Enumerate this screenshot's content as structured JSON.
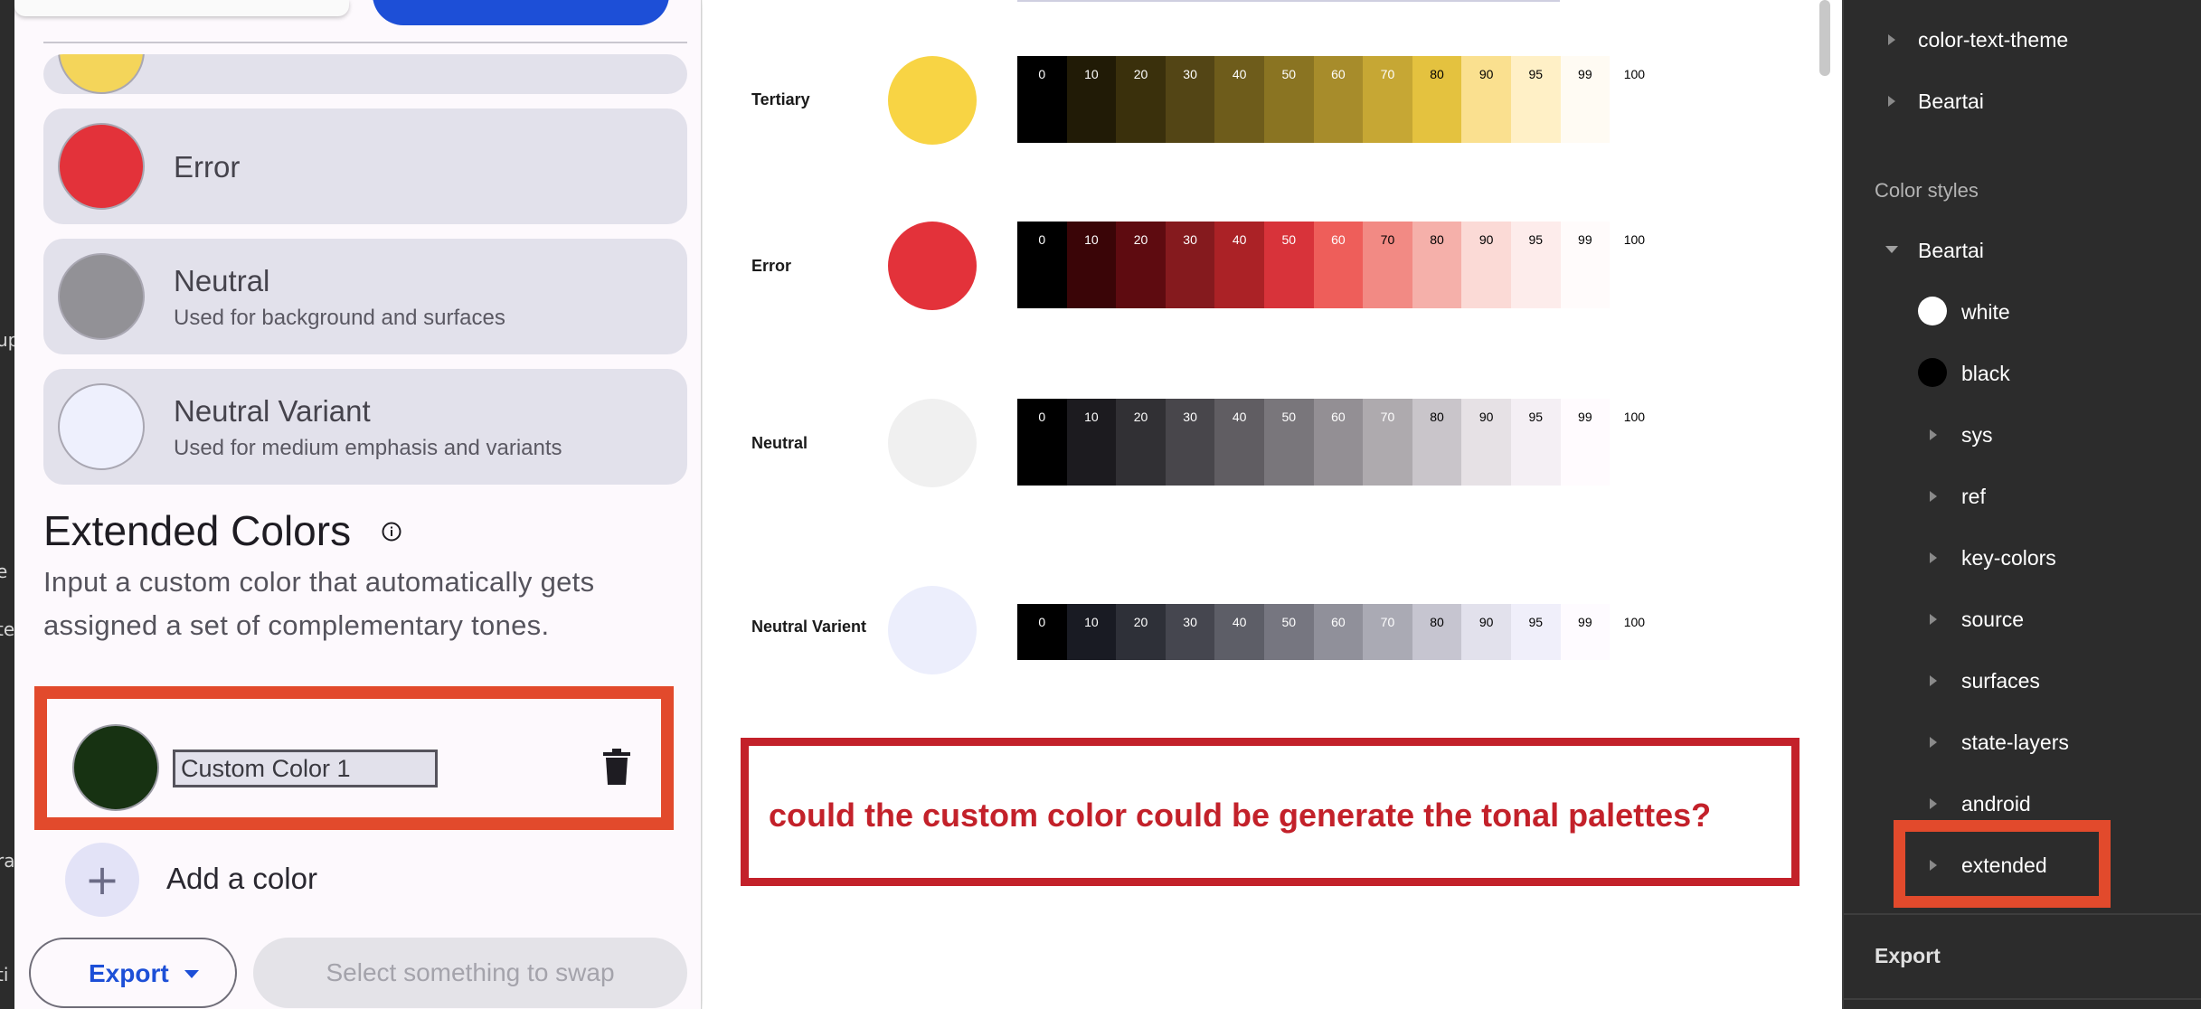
{
  "left_panel": {
    "cards": [
      {
        "title": "Error",
        "subtitle": "",
        "color": "#e3323a"
      },
      {
        "title": "Neutral",
        "subtitle": "Used for background and surfaces",
        "color": "#929196"
      },
      {
        "title": "Neutral Variant",
        "subtitle": "Used for medium emphasis and variants",
        "color": "#eef0fd"
      }
    ],
    "partial_card_color": "#f4d55a",
    "extended": {
      "title": "Extended Colors",
      "info_icon": "info-icon",
      "description": "Input a custom color that automatically gets assigned a set of complementary tones.",
      "custom_color": {
        "name_value": "Custom Color 1",
        "swatch_color": "#173212",
        "delete_icon": "trash-icon"
      },
      "add_label": "Add a color"
    },
    "export_label": "Export",
    "swap_label": "Select something to swap",
    "edge_fragments": [
      "up",
      "e",
      "te",
      "ra",
      "ti"
    ]
  },
  "palette": {
    "rows": [
      {
        "label": "Tertiary",
        "color": "#f8d444",
        "tones": [
          {
            "t": "0",
            "bg": "#000000",
            "fg": "#ffffff"
          },
          {
            "t": "10",
            "bg": "#211b06",
            "fg": "#ffffff"
          },
          {
            "t": "20",
            "bg": "#3a300c",
            "fg": "#ffffff"
          },
          {
            "t": "30",
            "bg": "#534515",
            "fg": "#ffffff"
          },
          {
            "t": "40",
            "bg": "#6e5c1b",
            "fg": "#ffffff"
          },
          {
            "t": "50",
            "bg": "#8a7422",
            "fg": "#ffffff"
          },
          {
            "t": "60",
            "bg": "#a78c2b",
            "fg": "#ffffff"
          },
          {
            "t": "70",
            "bg": "#c6a734",
            "fg": "#ffffff"
          },
          {
            "t": "80",
            "bg": "#e4c23f",
            "fg": "#000000"
          },
          {
            "t": "90",
            "bg": "#fae08f",
            "fg": "#000000"
          },
          {
            "t": "95",
            "bg": "#fff0c6",
            "fg": "#000000"
          },
          {
            "t": "99",
            "bg": "#fffbf3",
            "fg": "#000000"
          },
          {
            "t": "100",
            "bg": "#ffffff",
            "fg": "#000000"
          }
        ]
      },
      {
        "label": "Error",
        "color": "#e3323a",
        "tones": [
          {
            "t": "0",
            "bg": "#000000",
            "fg": "#ffffff"
          },
          {
            "t": "10",
            "bg": "#3a0507",
            "fg": "#ffffff"
          },
          {
            "t": "20",
            "bg": "#5e0b10",
            "fg": "#ffffff"
          },
          {
            "t": "30",
            "bg": "#851a1e",
            "fg": "#ffffff"
          },
          {
            "t": "40",
            "bg": "#ab2226",
            "fg": "#ffffff"
          },
          {
            "t": "50",
            "bg": "#d8333a",
            "fg": "#ffffff"
          },
          {
            "t": "60",
            "bg": "#ee5e5a",
            "fg": "#ffffff"
          },
          {
            "t": "70",
            "bg": "#f28a84",
            "fg": "#000000"
          },
          {
            "t": "80",
            "bg": "#f5b0aa",
            "fg": "#000000"
          },
          {
            "t": "90",
            "bg": "#fbdad6",
            "fg": "#000000"
          },
          {
            "t": "95",
            "bg": "#fdeceb",
            "fg": "#000000"
          },
          {
            "t": "99",
            "bg": "#fffbfb",
            "fg": "#000000"
          },
          {
            "t": "100",
            "bg": "#ffffff",
            "fg": "#000000"
          }
        ]
      },
      {
        "label": "Neutral",
        "color": "#f0f0f0",
        "tones": [
          {
            "t": "0",
            "bg": "#000000",
            "fg": "#ffffff"
          },
          {
            "t": "10",
            "bg": "#1c1b1f",
            "fg": "#ffffff"
          },
          {
            "t": "20",
            "bg": "#313034",
            "fg": "#ffffff"
          },
          {
            "t": "30",
            "bg": "#48464b",
            "fg": "#ffffff"
          },
          {
            "t": "40",
            "bg": "#605d62",
            "fg": "#ffffff"
          },
          {
            "t": "50",
            "bg": "#79767b",
            "fg": "#ffffff"
          },
          {
            "t": "60",
            "bg": "#938f94",
            "fg": "#ffffff"
          },
          {
            "t": "70",
            "bg": "#aeaaae",
            "fg": "#ffffff"
          },
          {
            "t": "80",
            "bg": "#c9c5ca",
            "fg": "#000000"
          },
          {
            "t": "90",
            "bg": "#e6e1e5",
            "fg": "#000000"
          },
          {
            "t": "95",
            "bg": "#f4eff4",
            "fg": "#000000"
          },
          {
            "t": "99",
            "bg": "#fffbfe",
            "fg": "#000000"
          },
          {
            "t": "100",
            "bg": "#ffffff",
            "fg": "#000000"
          }
        ]
      },
      {
        "label": "Neutral Varient",
        "color": "#eceefc",
        "tones": [
          {
            "t": "0",
            "bg": "#000000",
            "fg": "#ffffff"
          },
          {
            "t": "10",
            "bg": "#191b23",
            "fg": "#ffffff"
          },
          {
            "t": "20",
            "bg": "#2e3038",
            "fg": "#ffffff"
          },
          {
            "t": "30",
            "bg": "#45464f",
            "fg": "#ffffff"
          },
          {
            "t": "40",
            "bg": "#5d5e67",
            "fg": "#ffffff"
          },
          {
            "t": "50",
            "bg": "#767680",
            "fg": "#ffffff"
          },
          {
            "t": "60",
            "bg": "#90909a",
            "fg": "#ffffff"
          },
          {
            "t": "70",
            "bg": "#aaaab4",
            "fg": "#ffffff"
          },
          {
            "t": "80",
            "bg": "#c6c5d0",
            "fg": "#000000"
          },
          {
            "t": "90",
            "bg": "#e2e1ec",
            "fg": "#000000"
          },
          {
            "t": "95",
            "bg": "#f0effa",
            "fg": "#000000"
          },
          {
            "t": "99",
            "bg": "#fefbff",
            "fg": "#000000"
          },
          {
            "t": "100",
            "bg": "#ffffff",
            "fg": "#000000"
          }
        ]
      }
    ],
    "question": "could the custom color could be generate the tonal palettes?",
    "annotation_color": "#c3212a"
  },
  "right_panel": {
    "top_items": [
      "color-text-theme",
      "Beartai"
    ],
    "color_styles_heading": "Color styles",
    "group": "Beartai",
    "swatches": [
      {
        "label": "white",
        "color": "#ffffff"
      },
      {
        "label": "black",
        "color": "#000000"
      }
    ],
    "folders": [
      "sys",
      "ref",
      "key-colors",
      "source",
      "surfaces",
      "state-layers",
      "android",
      "extended"
    ],
    "export_heading": "Export",
    "highlight_color": "#e24a2c"
  }
}
